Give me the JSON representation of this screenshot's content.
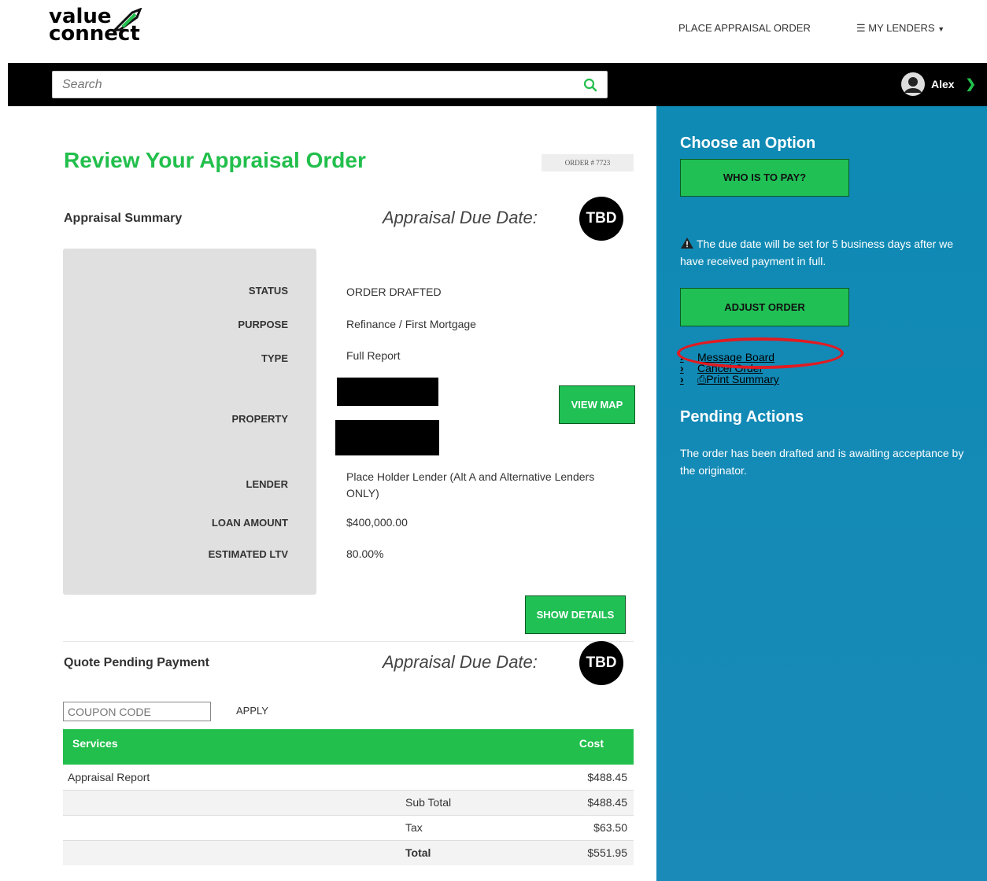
{
  "brand": {
    "line1": "value",
    "line2": "connect",
    "accent": "#22bf4c"
  },
  "nav": {
    "place_order": "PLACE APPRAISAL ORDER",
    "my_lenders": "MY LENDERS"
  },
  "search": {
    "placeholder": "Search"
  },
  "user": {
    "name": "Alex"
  },
  "page": {
    "title": "Review Your Appraisal Order",
    "order_number": "ORDER # 7723"
  },
  "summary": {
    "heading": "Appraisal Summary",
    "due_label": "Appraisal Due Date:",
    "due_value": "TBD",
    "fields": {
      "status_label": "STATUS",
      "status": "ORDER DRAFTED",
      "purpose_label": "PURPOSE",
      "purpose": "Refinance / First Mortgage",
      "type_label": "TYPE",
      "type": "Full Report",
      "property_label": "PROPERTY",
      "lender_label": "LENDER",
      "lender": "Place Holder Lender (Alt A and Alternative Lenders ONLY)",
      "loan_label": "LOAN AMOUNT",
      "loan": "$400,000.00",
      "ltv_label": "ESTIMATED LTV",
      "ltv": "80.00%"
    },
    "view_map": "VIEW MAP",
    "show_details": "SHOW DETAILS"
  },
  "quote": {
    "heading": "Quote Pending Payment",
    "due_label": "Appraisal Due Date:",
    "due_value": "TBD",
    "coupon_placeholder": "COUPON CODE",
    "apply": "APPLY",
    "table": {
      "col_services": "Services",
      "col_cost": "Cost",
      "service_name": "Appraisal Report",
      "service_cost": "$488.45",
      "subtotal_label": "Sub Total",
      "subtotal": "$488.45",
      "tax_label": "Tax",
      "tax": "$63.50",
      "total_label": "Total",
      "total": "$551.95"
    }
  },
  "sidebar": {
    "title": "Choose an Option",
    "who_pays": "WHO IS TO PAY?",
    "note": "The due date will be set for 5 business days after we have received payment in full.",
    "adjust": "ADJUST ORDER",
    "links": {
      "message_board": "Message Board",
      "cancel_order": "Cancel Order",
      "print_summary": "Print Summary"
    },
    "pending_title": "Pending Actions",
    "pending_text": "The order has been drafted and is awaiting acceptance by the originator."
  }
}
